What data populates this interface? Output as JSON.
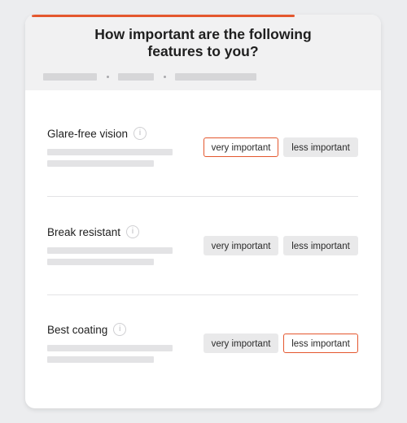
{
  "survey": {
    "title_line1": "How important are the following",
    "title_line2": "features to you?",
    "progress": 0.74
  },
  "options": {
    "very": "very important",
    "less": "less important"
  },
  "features": [
    {
      "label": "Glare-free vision",
      "selected": "very important"
    },
    {
      "label": "Break resistant",
      "selected": null
    },
    {
      "label": "Best coating",
      "selected": "less important"
    }
  ],
  "icons": {
    "info": "info-icon"
  },
  "colors": {
    "accent": "#e4572e",
    "header_bg": "#f1f1f2",
    "button_bg": "#e9e9ea"
  }
}
